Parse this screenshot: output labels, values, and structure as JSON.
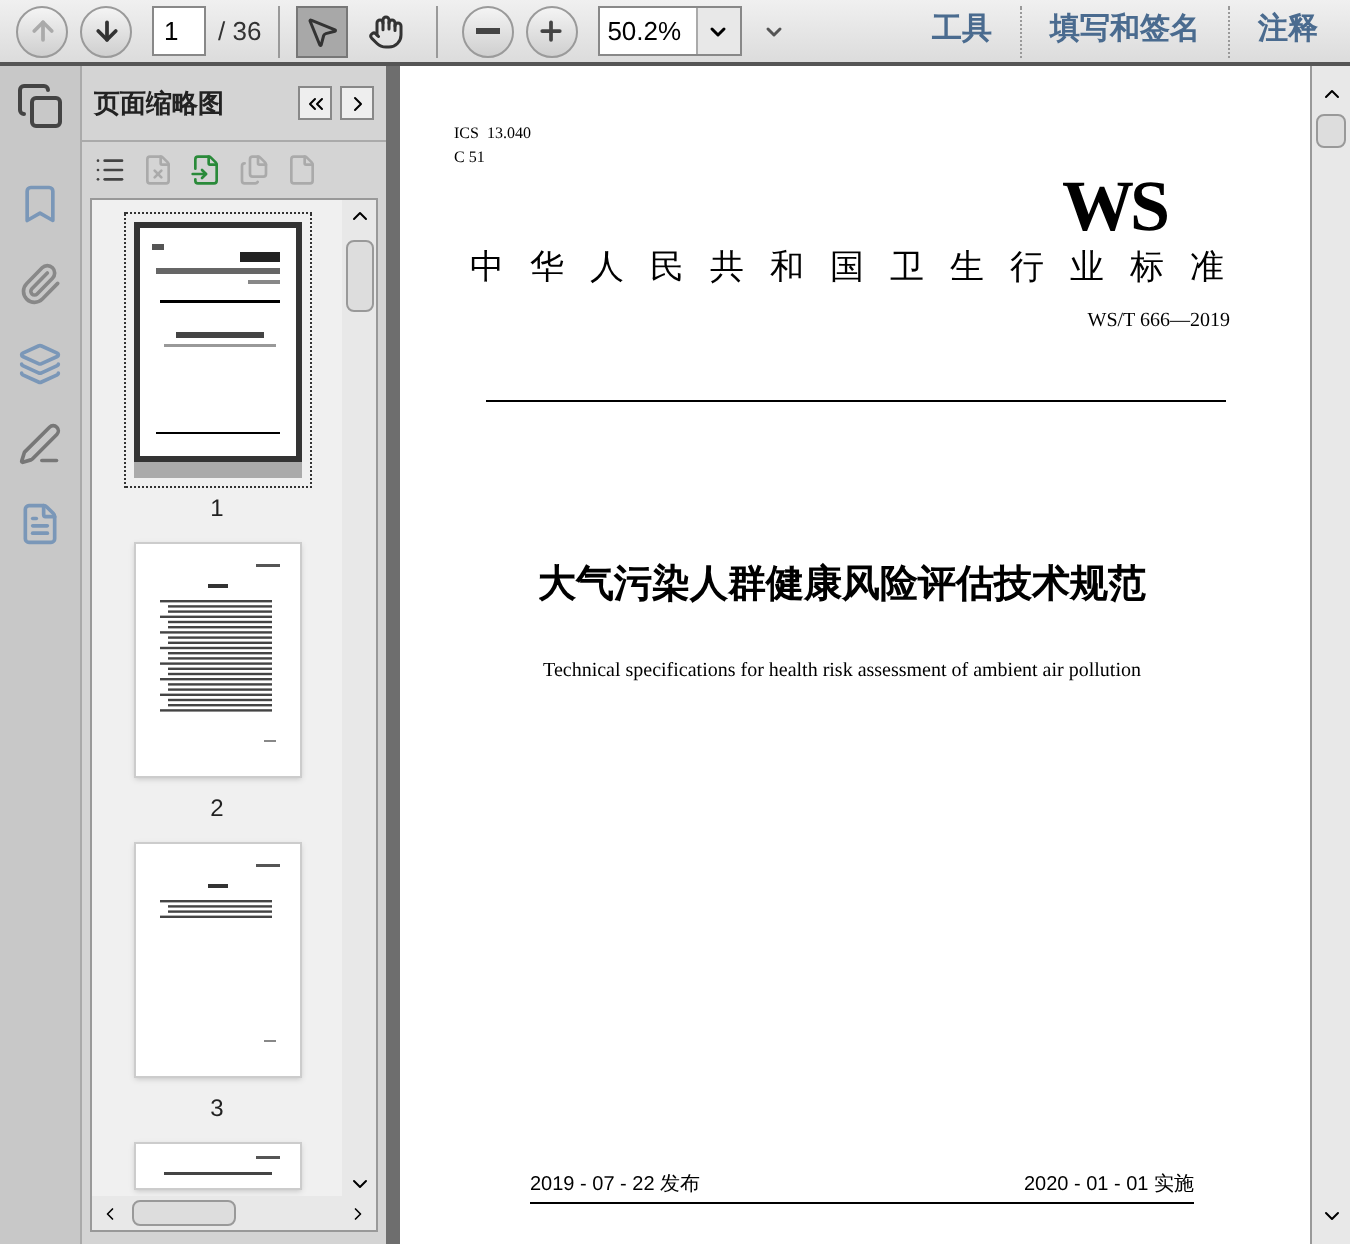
{
  "toolbar": {
    "page_value": "1",
    "page_total": "/ 36",
    "zoom_value": "50.2%",
    "tools": [
      {
        "kind": "select",
        "selected": true
      },
      {
        "kind": "hand",
        "selected": false
      }
    ],
    "menus": [
      "工具",
      "填写和签名",
      "注释"
    ]
  },
  "panel": {
    "title": "页面缩略图",
    "thumbnails": [
      {
        "label": "1",
        "kind": "cover",
        "selected": true
      },
      {
        "label": "2",
        "kind": "contents",
        "selected": false
      },
      {
        "label": "3",
        "kind": "foreword",
        "selected": false
      },
      {
        "kind": "partial",
        "selected": false
      }
    ]
  },
  "document": {
    "codes": [
      "ICS  13.040",
      "C 51"
    ],
    "logo": "WS",
    "org": "中华人民共和国卫生行业标准",
    "number": "WS/T 666—2019",
    "title": "大气污染人群健康风险评估技术规范",
    "subtitle": "Technical specifications for health risk assessment of ambient air pollution",
    "issued": "2019 - 07 - 22 发布",
    "effective": "2020 - 01 - 01 实施"
  }
}
